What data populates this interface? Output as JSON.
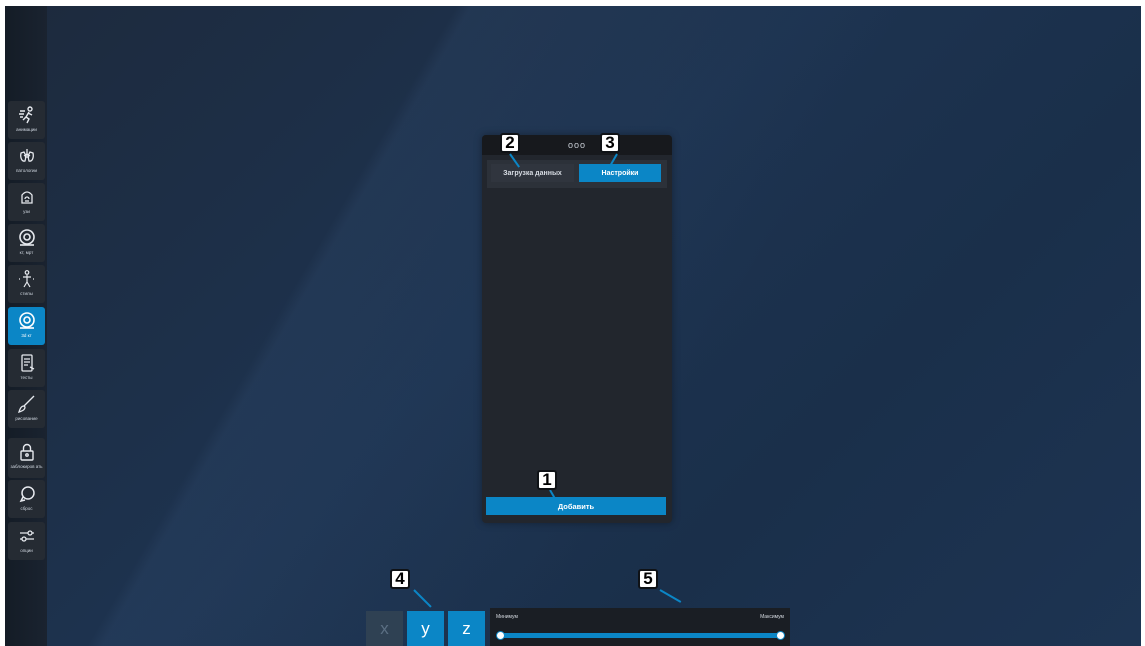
{
  "sidebar": {
    "items": [
      {
        "label": "анимации",
        "icon": "running-figure-icon",
        "active": false
      },
      {
        "label": "патологии",
        "icon": "organs-icon",
        "active": false
      },
      {
        "label": "узи",
        "icon": "ultrasound-probe-icon",
        "active": false
      },
      {
        "label": "кт, мрт",
        "icon": "ct-scanner-icon",
        "active": false
      },
      {
        "label": "стилы",
        "icon": "skeleton-figure-icon",
        "active": false
      },
      {
        "label": "3d кт",
        "icon": "ct-3d-icon",
        "active": true
      },
      {
        "label": "тесты",
        "icon": "clipboard-test-icon",
        "active": false
      },
      {
        "label": "рисование",
        "icon": "brush-icon",
        "active": false
      },
      {
        "label": "заблокиров ать",
        "icon": "lock-icon",
        "active": false
      },
      {
        "label": "сброс",
        "icon": "reset-arrow-icon",
        "active": false
      },
      {
        "label": "опции",
        "icon": "sliders-icon",
        "active": false
      }
    ]
  },
  "panel": {
    "menu_dots": "ооо",
    "tabs": [
      {
        "label": "Загрузка данных",
        "active": false
      },
      {
        "label": "Настройки",
        "active": true
      }
    ],
    "add_button": "Добавить"
  },
  "axes": {
    "x": "x",
    "y": "y",
    "z": "z",
    "selected": [
      "y",
      "z"
    ]
  },
  "range_slider": {
    "min_label": "Минимум",
    "max_label": "Максимум",
    "min_value": 0,
    "max_value": 1
  },
  "callouts": [
    "1",
    "2",
    "3",
    "4",
    "5"
  ],
  "colors": {
    "accent": "#0b86c6",
    "background": "#1d3350",
    "panel": "#22262d"
  }
}
